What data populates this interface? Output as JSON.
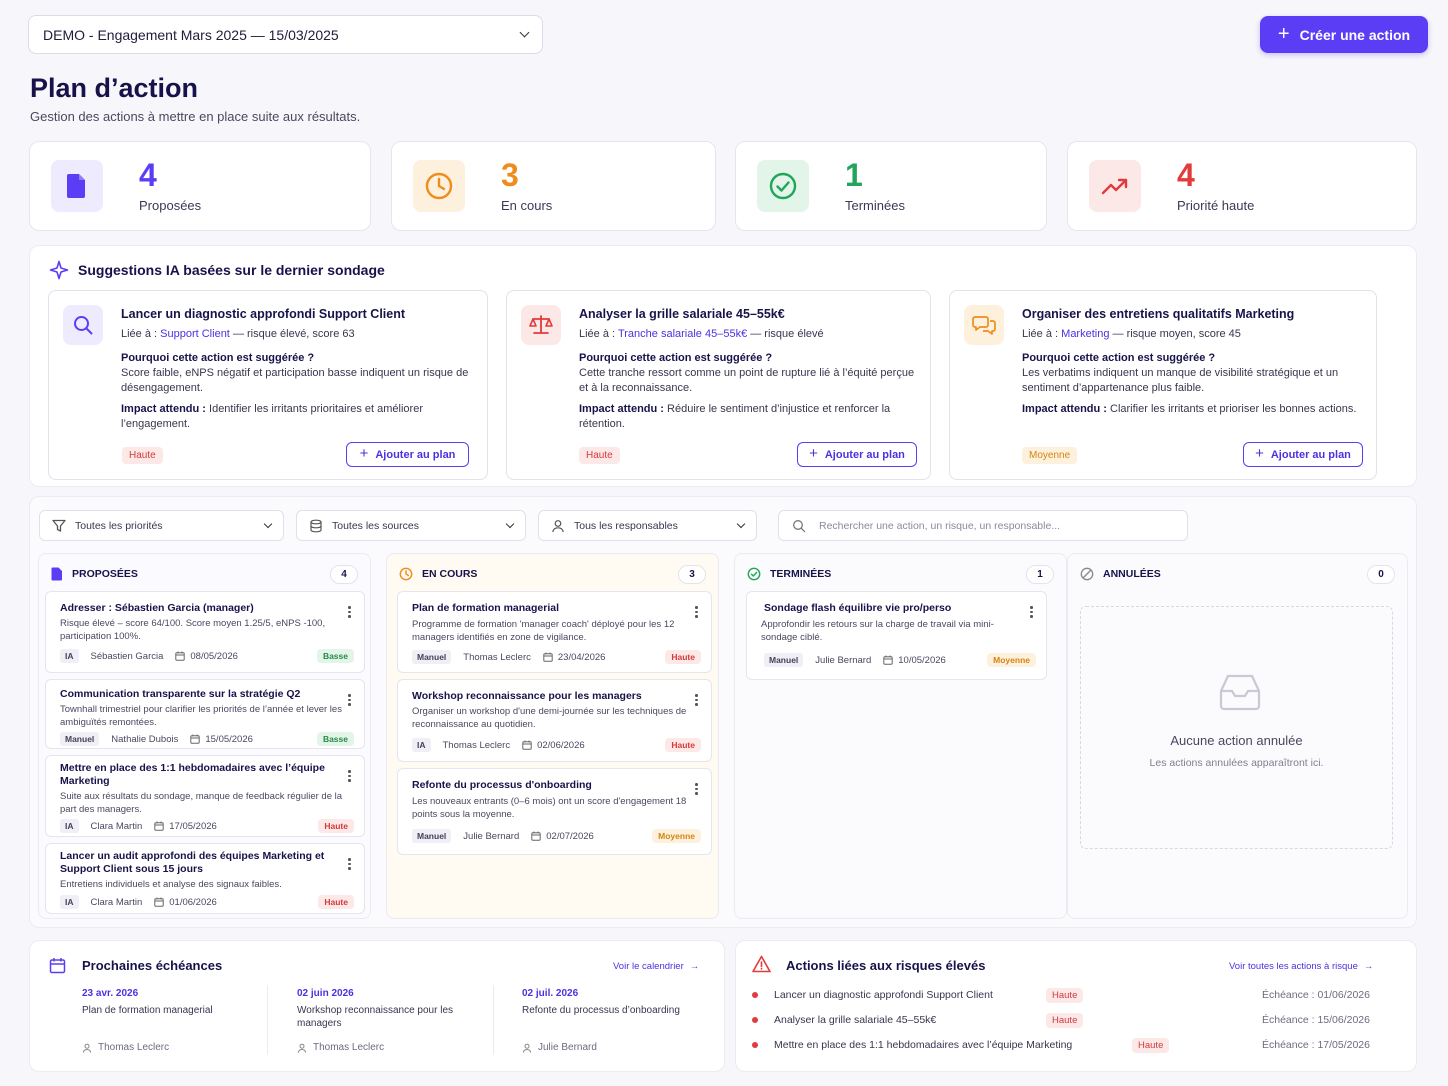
{
  "header": {
    "survey_select": "DEMO - Engagement Mars 2025 — 15/03/2025",
    "create_button": "Créer une action",
    "title": "Plan d’action",
    "subtitle": "Gestion des actions à mettre en place suite aux résultats."
  },
  "stats": [
    {
      "value": "4",
      "label": "Proposées",
      "color": "#5b3df5",
      "bg": "#eeebfe",
      "icon": "document-icon"
    },
    {
      "value": "3",
      "label": "En cours",
      "color": "#f08c1c",
      "bg": "#fdf0dd",
      "icon": "clock-icon"
    },
    {
      "value": "1",
      "label": "Terminées",
      "color": "#21a559",
      "bg": "#e3f5e9",
      "icon": "check-circle-icon"
    },
    {
      "value": "4",
      "label": "Priorité haute",
      "color": "#e23b3b",
      "bg": "#fde8e8",
      "icon": "trending-up-icon"
    }
  ],
  "suggestions": {
    "title": "Suggestions IA basées sur le dernier sondage",
    "why_label": "Pourquoi cette action est suggérée ?",
    "impact_label": "Impact attendu :",
    "add_label": "Ajouter au plan",
    "cards": [
      {
        "title": "Lancer un diagnostic approfondi Support Client",
        "linked_prefix": "Liée à :",
        "linked": "Support Client",
        "linked_suffix": "— risque élevé, score 63",
        "why": "Score faible, eNPS négatif et participation basse indiquent un risque de désengagement.",
        "impact": "Identifier les irritants prioritaires et améliorer l’engagement.",
        "priority": "Haute"
      },
      {
        "title": "Analyser la grille salariale 45–55k€",
        "linked_prefix": "Liée à :",
        "linked": "Tranche salariale 45–55k€",
        "linked_suffix": "— risque élevé",
        "why": "Cette tranche ressort comme un point de rupture lié à l’équité perçue et à la reconnaissance.",
        "impact": "Réduire le sentiment d’injustice et renforcer la rétention.",
        "priority": "Haute"
      },
      {
        "title": "Organiser des entretiens qualitatifs Marketing",
        "linked_prefix": "Liée à :",
        "linked": "Marketing",
        "linked_suffix": "— risque moyen, score 45",
        "why": "Les verbatims indiquent un manque de visibilité stratégique et un sentiment d’appartenance plus faible.",
        "impact": "Clarifier les irritants et prioriser les bonnes actions.",
        "priority": "Moyenne"
      }
    ]
  },
  "filters": {
    "priority": "Toutes les priorités",
    "source": "Toutes les sources",
    "owner": "Tous les responsables",
    "search_placeholder": "Rechercher une action, un risque, un responsable..."
  },
  "columns": {
    "proposed": {
      "title": "PROPOSÉES",
      "count": "4",
      "cards": [
        {
          "title": "Adresser : Sébastien Garcia (manager)",
          "desc": "Risque élevé – score 64/100. Score moyen 1.25/5, eNPS -100, participation 100%.",
          "source": "IA",
          "owner": "Sébastien Garcia",
          "date": "08/05/2026",
          "priority": "Basse"
        },
        {
          "title": "Communication transparente sur la stratégie Q2",
          "desc": "Townhall trimestriel pour clarifier les priorités de l’année et lever les ambiguïtés remontées.",
          "source": "Manuel",
          "owner": "Nathalie Dubois",
          "date": "15/05/2026",
          "priority": "Basse"
        },
        {
          "title": "Mettre en place des 1:1 hebdomadaires avec l’équipe Marketing",
          "desc": "Suite aux résultats du sondage, manque de feedback régulier de la part des managers.",
          "source": "IA",
          "owner": "Clara Martin",
          "date": "17/05/2026",
          "priority": "Haute"
        },
        {
          "title": "Lancer un audit approfondi des équipes Marketing et Support Client sous 15 jours",
          "desc": "Entretiens individuels et analyse des signaux faibles.",
          "source": "IA",
          "owner": "Clara Martin",
          "date": "01/06/2026",
          "priority": "Haute"
        }
      ]
    },
    "in_progress": {
      "title": "EN COURS",
      "count": "3",
      "cards": [
        {
          "title": "Plan de formation managerial",
          "desc": "Programme de formation 'manager coach' déployé pour les 12 managers identifiés en zone de vigilance.",
          "source": "Manuel",
          "owner": "Thomas Leclerc",
          "date": "23/04/2026",
          "priority": "Haute"
        },
        {
          "title": "Workshop reconnaissance pour les managers",
          "desc": "Organiser un workshop d'une demi-journée sur les techniques de reconnaissance au quotidien.",
          "source": "IA",
          "owner": "Thomas Leclerc",
          "date": "02/06/2026",
          "priority": "Haute"
        },
        {
          "title": "Refonte du processus d'onboarding",
          "desc": "Les nouveaux entrants (0–6 mois) ont un score d'engagement 18 points sous la moyenne.",
          "source": "Manuel",
          "owner": "Julie Bernard",
          "date": "02/07/2026",
          "priority": "Moyenne"
        }
      ]
    },
    "done": {
      "title": "TERMINÉES",
      "count": "1",
      "cards": [
        {
          "title": "Sondage flash équilibre vie pro/perso",
          "desc": "Approfondir les retours sur la charge de travail via mini-sondage ciblé.",
          "source": "Manuel",
          "owner": "Julie Bernard",
          "date": "10/05/2026",
          "priority": "Moyenne"
        }
      ]
    },
    "cancelled": {
      "title": "ANNULÉES",
      "count": "0",
      "empty_title": "Aucune action annulée",
      "empty_sub": "Les actions annulées apparaîtront ici."
    }
  },
  "deadlines": {
    "title": "Prochaines échéances",
    "link": "Voir le calendrier",
    "items": [
      {
        "date": "23 avr. 2026",
        "title": "Plan de formation managerial",
        "owner": "Thomas Leclerc"
      },
      {
        "date": "02 juin 2026",
        "title": "Workshop reconnaissance pour les managers",
        "owner": "Thomas Leclerc"
      },
      {
        "date": "02 juil. 2026",
        "title": "Refonte du processus d’onboarding",
        "owner": "Julie Bernard"
      }
    ]
  },
  "risks": {
    "title": "Actions liées aux risques élevés",
    "link": "Voir toutes les actions à risque",
    "items": [
      {
        "title": "Lancer un diagnostic approfondi Support Client",
        "priority": "Haute",
        "due": "Échéance : 01/06/2026"
      },
      {
        "title": "Analyser la grille salariale 45–55k€",
        "priority": "Haute",
        "due": "Échéance : 15/06/2026"
      },
      {
        "title": "Mettre en place des 1:1 hebdomadaires avec l’équipe Marketing",
        "priority": "Haute",
        "due": "Échéance : 17/05/2026"
      }
    ]
  }
}
